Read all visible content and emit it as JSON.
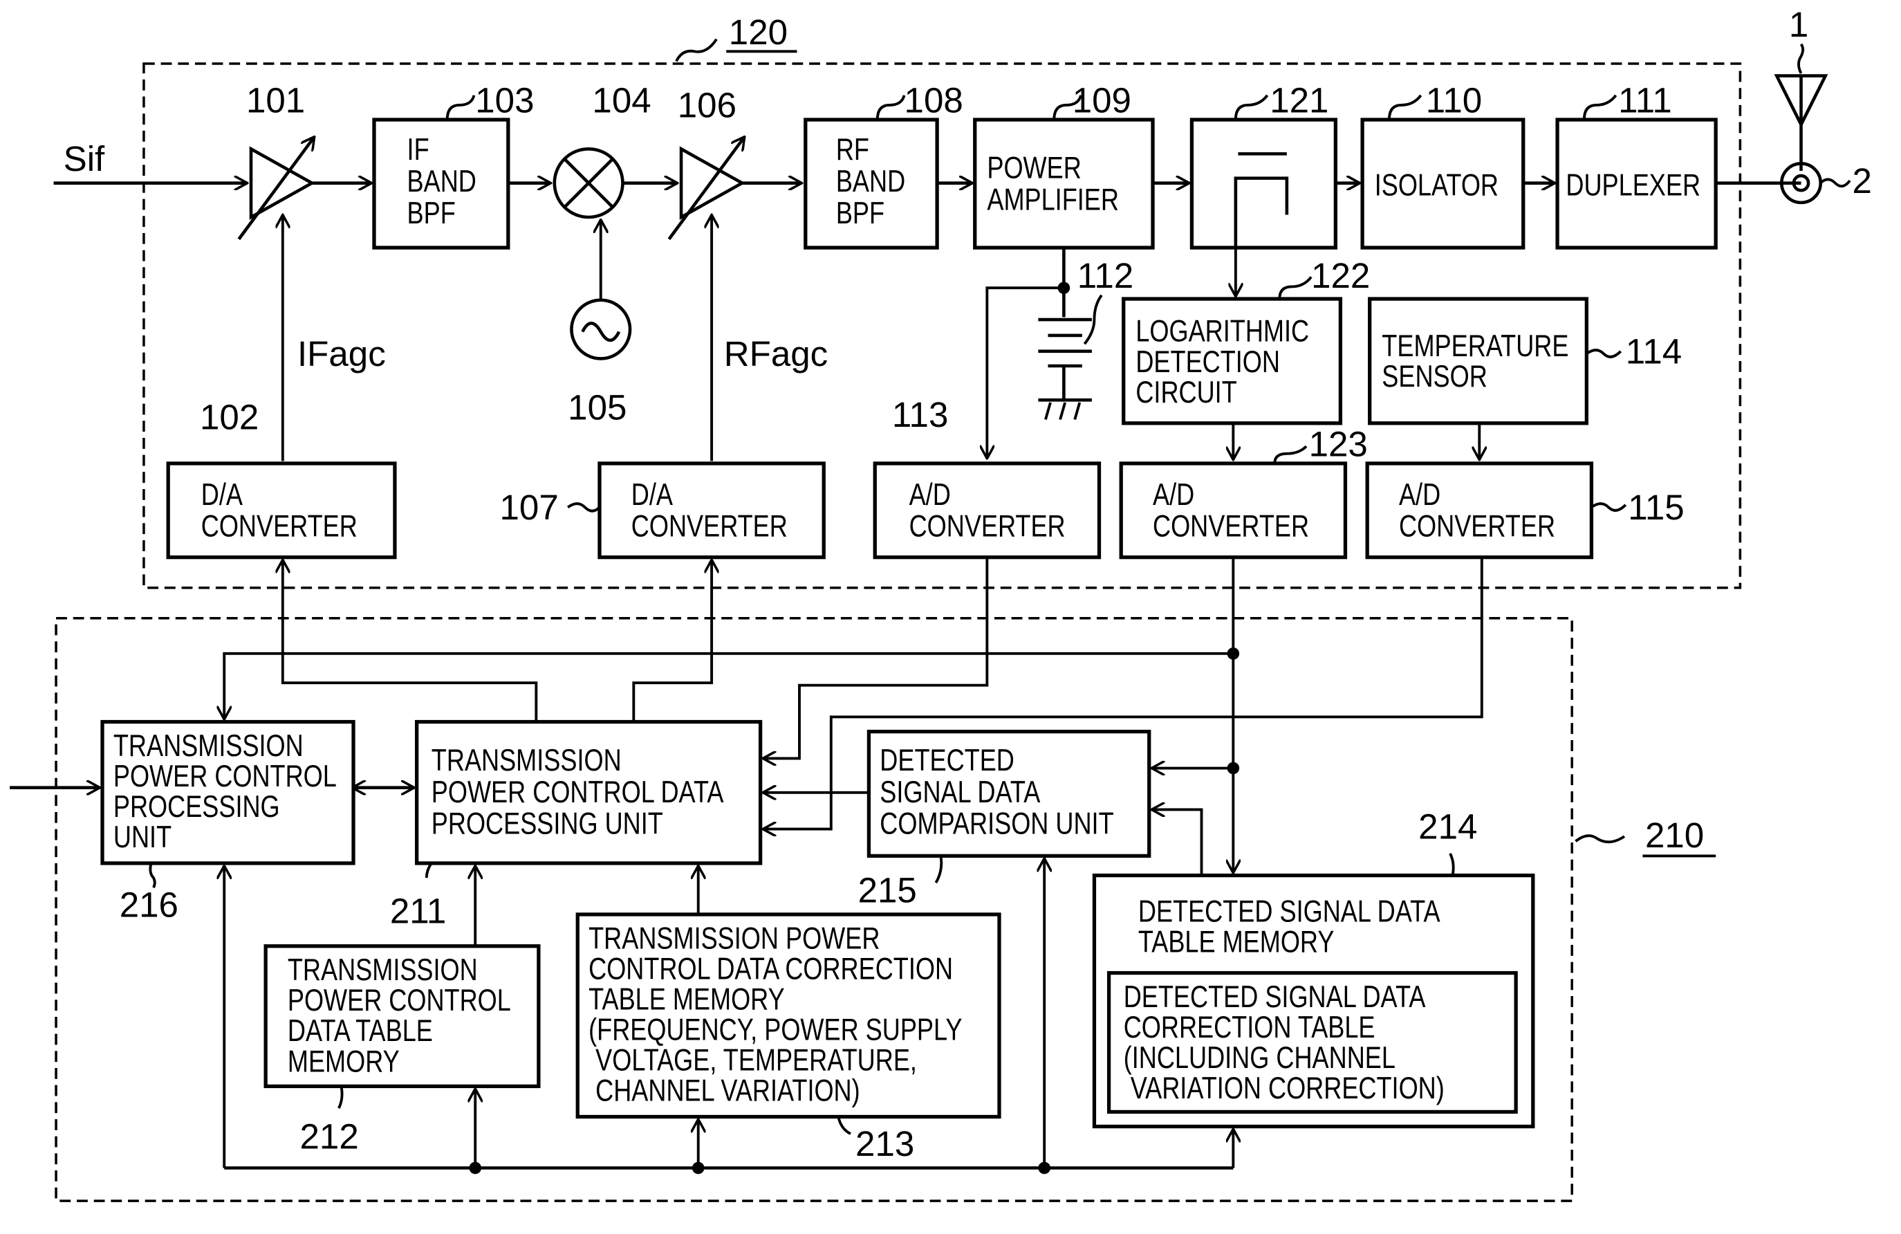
{
  "figure": {
    "groups": {
      "rf_section": {
        "ref": "120"
      },
      "control_section": {
        "ref": "210"
      }
    },
    "signals": {
      "input": "Sif",
      "if_agc": "IFagc",
      "rf_agc": "RFagc"
    },
    "blocks": {
      "b101": {
        "ref": "101",
        "lines": []
      },
      "b103": {
        "ref": "103",
        "lines": [
          "IF",
          "BAND",
          "BPF"
        ]
      },
      "b104": {
        "ref": "104"
      },
      "b105": {
        "ref": "105"
      },
      "b106": {
        "ref": "106"
      },
      "b108": {
        "ref": "108",
        "lines": [
          "RF",
          "BAND",
          "BPF"
        ]
      },
      "b109": {
        "ref": "109",
        "lines": [
          "POWER",
          "AMPLIFIER"
        ]
      },
      "b121": {
        "ref": "121"
      },
      "b110": {
        "ref": "110",
        "lines": [
          "ISOLATOR"
        ]
      },
      "b111": {
        "ref": "111",
        "lines": [
          "DUPLEXER"
        ]
      },
      "b1": {
        "ref": "1"
      },
      "b2": {
        "ref": "2"
      },
      "b112": {
        "ref": "112"
      },
      "b122": {
        "ref": "122",
        "lines": [
          "LOGARITHMIC",
          "DETECTION",
          "CIRCUIT"
        ]
      },
      "b114": {
        "ref": "114",
        "lines": [
          "TEMPERATURE",
          "SENSOR"
        ]
      },
      "b102": {
        "ref": "102",
        "lines": [
          "D/A",
          "CONVERTER"
        ]
      },
      "b107": {
        "ref": "107",
        "lines": [
          "D/A",
          "CONVERTER"
        ]
      },
      "b113": {
        "ref": "113",
        "lines": [
          "A/D",
          "CONVERTER"
        ]
      },
      "b123": {
        "ref": "123",
        "lines": [
          "A/D",
          "CONVERTER"
        ]
      },
      "b115": {
        "ref": "115",
        "lines": [
          "A/D",
          "CONVERTER"
        ]
      },
      "b216": {
        "ref": "216",
        "lines": [
          "TRANSMISSION",
          "POWER CONTROL",
          "PROCESSING",
          "UNIT"
        ]
      },
      "b211": {
        "ref": "211",
        "lines": [
          "TRANSMISSION",
          "POWER CONTROL DATA",
          "PROCESSING UNIT"
        ]
      },
      "b215": {
        "ref": "215",
        "lines": [
          "DETECTED",
          "SIGNAL DATA",
          "COMPARISON UNIT"
        ]
      },
      "b212": {
        "ref": "212",
        "lines": [
          "TRANSMISSION",
          "POWER CONTROL",
          "DATA TABLE",
          "MEMORY"
        ]
      },
      "b213": {
        "ref": "213",
        "lines": [
          "TRANSMISSION POWER",
          "CONTROL DATA CORRECTION",
          "TABLE MEMORY",
          "(FREQUENCY, POWER SUPPLY",
          " VOLTAGE, TEMPERATURE,",
          " CHANNEL VARIATION)"
        ]
      },
      "b214": {
        "ref": "214",
        "lines": [
          "DETECTED SIGNAL DATA",
          "TABLE MEMORY"
        ]
      },
      "b214_inner": {
        "lines": [
          "DETECTED SIGNAL DATA",
          "CORRECTION TABLE",
          "(INCLUDING CHANNEL",
          " VARIATION CORRECTION)"
        ]
      }
    }
  }
}
